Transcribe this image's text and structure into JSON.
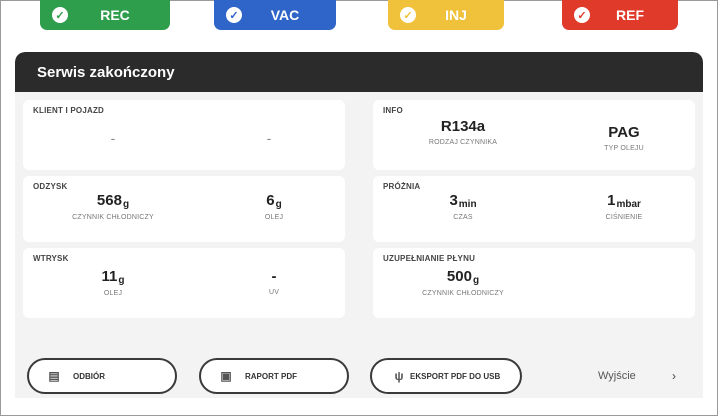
{
  "tabs": [
    {
      "label": "REC",
      "color": "#2e9d4c"
    },
    {
      "label": "VAC",
      "color": "#2f64c8"
    },
    {
      "label": "INJ",
      "color": "#f0c13a"
    },
    {
      "label": "REF",
      "color": "#e03a2a"
    }
  ],
  "header": {
    "title": "Serwis zakończony"
  },
  "client": {
    "title": "KLIENT I POJAZD",
    "left": "-",
    "right": "-"
  },
  "info": {
    "title": "INFO",
    "refrigerant_value": "R134a",
    "refrigerant_label": "RODZAJ CZYNNIKA",
    "oil_value": "PAG",
    "oil_label": "TYP OLEJU"
  },
  "recovery": {
    "title": "ODZYSK",
    "refrigerant_value": "568",
    "refrigerant_unit": "g",
    "refrigerant_label": "CZYNNIK CHŁODNICZY",
    "oil_value": "6",
    "oil_unit": "g",
    "oil_label": "OLEJ"
  },
  "vacuum": {
    "title": "PRÓŻNIA",
    "time_value": "3",
    "time_unit": "min",
    "time_label": "CZAS",
    "pressure_value": "1",
    "pressure_unit": "mbar",
    "pressure_label": "CIŚNIENIE"
  },
  "injection": {
    "title": "WTRYSK",
    "oil_value": "11",
    "oil_unit": "g",
    "oil_label": "OLEJ",
    "uv_value": "-",
    "uv_label": "UV"
  },
  "charge": {
    "title": "UZUPEŁNIANIE PŁYNU",
    "value": "500",
    "unit": "g",
    "label": "CZYNNIK CHŁODNICZY"
  },
  "buttons": {
    "receipt": "ODBIÓR",
    "pdf_report": "RAPORT PDF",
    "export_usb": "EKSPORT PDF DO USB",
    "exit": "Wyjście",
    "exit_chevron": "›"
  }
}
